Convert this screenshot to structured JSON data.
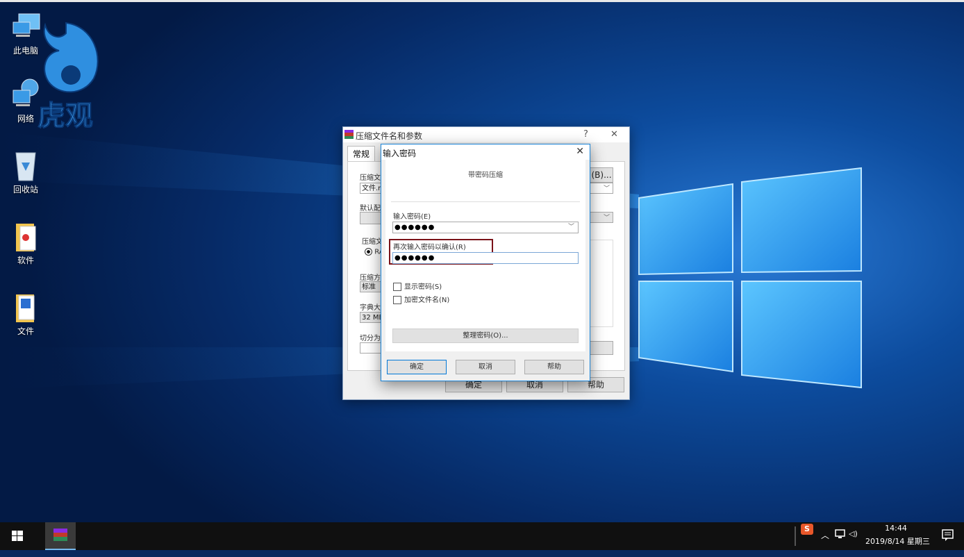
{
  "desktop": {
    "logo_text": "虎观",
    "icons": [
      {
        "label": "此电脑",
        "icon": "computer-icon"
      },
      {
        "label": "网络",
        "icon": "network-icon"
      },
      {
        "label": "回收站",
        "icon": "recycle-bin-icon"
      },
      {
        "label": "软件",
        "icon": "folder-icon"
      },
      {
        "label": "文件",
        "icon": "folder-doc-icon"
      }
    ]
  },
  "parent_dialog": {
    "title": "压缩文件名和参数",
    "help_glyph": "?",
    "close_glyph": "✕",
    "tab_general": "常规",
    "label_archive_name": "压缩文",
    "archive_name_value": "文件.ra",
    "browse_label": "(B)...",
    "label_default_profile": "默认配",
    "label_archive_format": "压缩文",
    "format_rar": "RA",
    "label_method": "压缩方",
    "method_value": "标准",
    "label_dictionary": "字典大",
    "dictionary_value": "32 MB",
    "label_split": "切分为",
    "ok_label": "确定",
    "cancel_label": "取消",
    "help_label": "帮助"
  },
  "password_dialog": {
    "title": "输入密码",
    "close_glyph": "✕",
    "heading": "带密码压缩",
    "label_password": "输入密码(E)",
    "password_value": "●●●●●●",
    "label_confirm": "再次输入密码以确认(R)",
    "confirm_value": "●●●●●●",
    "show_password_label": "显示密码(S)",
    "encrypt_filenames_label": "加密文件名(N)",
    "organize_label": "整理密码(O)...",
    "ok_label": "确定",
    "cancel_label": "取消",
    "help_label": "帮助"
  },
  "taskbar": {
    "time": "14:44",
    "date": "2019/8/14 星期三",
    "ime_label": "S",
    "volume_glyph": "◁)"
  },
  "colors": {
    "highlight_box": "#7a1218",
    "accent": "#0078d7"
  }
}
